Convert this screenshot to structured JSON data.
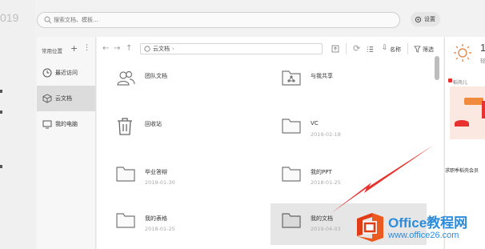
{
  "left_strip": {
    "year_fragment": "019"
  },
  "search": {
    "placeholder": "搜索文档、模板..."
  },
  "settings": {
    "label": "设置"
  },
  "nav": {
    "header": "常用位置",
    "items": [
      {
        "label": "最近访问",
        "icon": "clock-icon"
      },
      {
        "label": "云文档",
        "icon": "cloud-box-icon",
        "active": true
      },
      {
        "label": "我的电脑",
        "icon": "monitor-icon"
      }
    ]
  },
  "toolbar": {
    "path": "云文档",
    "sort_label": "名称",
    "filter_label": "筛选"
  },
  "files": [
    {
      "name": "团队文档",
      "date": "",
      "icon": "team-folder-icon"
    },
    {
      "name": "与我共享",
      "date": "",
      "icon": "shared-folder-icon"
    },
    {
      "name": "回收站",
      "date": "",
      "icon": "trash-icon"
    },
    {
      "name": "VC",
      "date": "2019-02-18",
      "icon": "folder-icon"
    },
    {
      "name": "毕业答辩",
      "date": "2019-01-30",
      "icon": "folder-icon"
    },
    {
      "name": "我的PPT",
      "date": "2018-01-25",
      "icon": "folder-icon"
    },
    {
      "name": "我的表格",
      "date": "2018-01-25",
      "icon": "folder-icon"
    },
    {
      "name": "我的文档",
      "date": "2019-04-03",
      "icon": "folder-icon",
      "selected": true
    }
  ],
  "right_panel": {
    "weather_value": "1",
    "weather_sub": "轻",
    "title": "稻壳儿",
    "ad_text": "求职季稻壳会员"
  },
  "watermark": {
    "title": "Office教程网",
    "url": "www.office26.com"
  },
  "colors": {
    "accent_red": "#e8322f",
    "watermark_blue": "#2c8cdb",
    "office_orange": "#eb5a1e"
  }
}
